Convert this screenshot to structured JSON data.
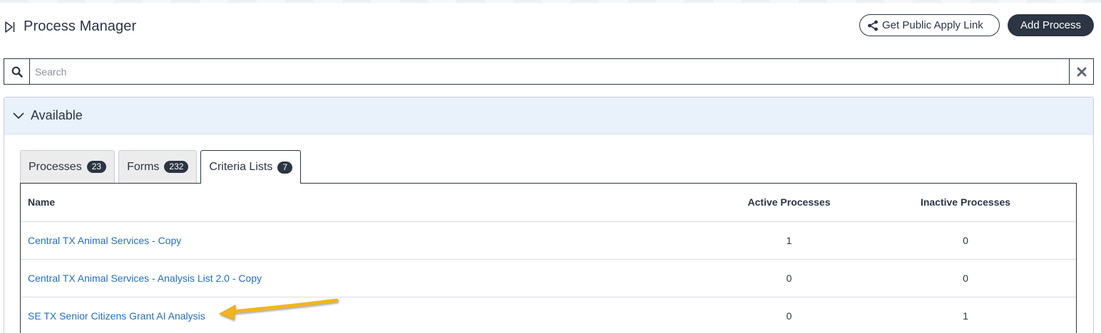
{
  "header": {
    "title": "Process Manager",
    "public_link_label": "Get Public Apply Link",
    "add_process_label": "Add Process"
  },
  "search": {
    "placeholder": "Search",
    "value": ""
  },
  "panel": {
    "title": "Available"
  },
  "tabs": [
    {
      "label": "Processes",
      "count": "23",
      "active": false
    },
    {
      "label": "Forms",
      "count": "232",
      "active": false
    },
    {
      "label": "Criteria Lists",
      "count": "7",
      "active": true
    }
  ],
  "table": {
    "columns": [
      "Name",
      "Active Processes",
      "Inactive Processes"
    ],
    "rows": [
      {
        "name": "Central TX Animal Services - Copy",
        "active": "1",
        "inactive": "0"
      },
      {
        "name": "Central TX Animal Services - Analysis List 2.0 - Copy",
        "active": "0",
        "inactive": "0"
      },
      {
        "name": "SE TX Senior Citizens Grant AI Analysis",
        "active": "0",
        "inactive": "1"
      }
    ]
  },
  "colors": {
    "primary": "#2b3544",
    "link": "#1f6fc5",
    "panel_header_bg": "#e9f1fb",
    "annotation_arrow": "#f2b51c"
  },
  "icons": {
    "collapse": "sidebar-toggle-icon",
    "share": "share-icon",
    "search": "search-icon",
    "clear": "close-icon",
    "panel_toggle": "chevron-down-icon",
    "annotation": "arrow-annotation"
  }
}
